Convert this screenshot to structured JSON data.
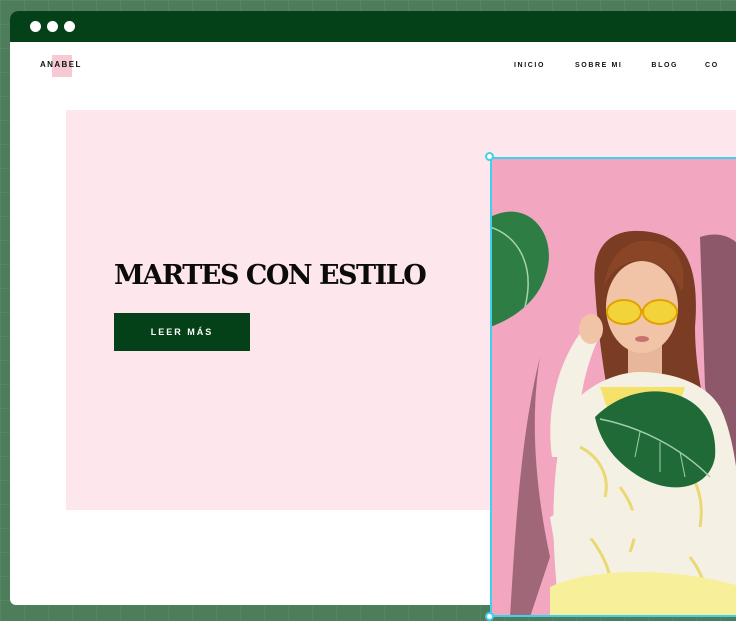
{
  "window": {
    "controls": [
      "close",
      "minimize",
      "maximize"
    ]
  },
  "site": {
    "logo": "ANABEL",
    "nav": [
      "INICIO",
      "SOBRE MI",
      "BLOG",
      "CO"
    ]
  },
  "hero": {
    "headline": "MARTES CON ESTILO",
    "cta_label": "LEER MÁS"
  },
  "colors": {
    "backdrop": "#4e7d5b",
    "titlebar": "#044119",
    "hero_bg": "#fde6ec",
    "cta_bg": "#044119",
    "selection": "#3fd0ee",
    "photo_bg": "#f2a6bf"
  },
  "icons": [
    "window-dot-icon",
    "resize-handle-icon"
  ]
}
